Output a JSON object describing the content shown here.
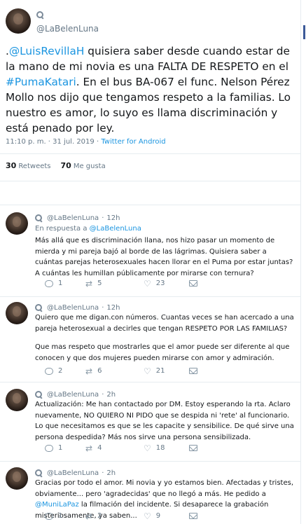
{
  "main_tweet": {
    "handle": "@LaBelenLuna",
    "text_parts": [
      {
        "t": ".",
        "link": false
      },
      {
        "t": "@LuisRevillaH",
        "link": true
      },
      {
        "t": " quisiera saber desde cuando estar de la mano de mi novia es una FALTA DE RESPETO en el ",
        "link": false
      },
      {
        "t": "#PumaKatari",
        "link": true
      },
      {
        "t": ". En el bus BA-067 el func. Nelson Pérez Mollo nos dijo que tengamos respeto a la familias. Lo nuestro es amor, lo suyo es llama discriminación y está penado por ley.",
        "link": false
      }
    ],
    "timestamp": "11:10 p. m. · 31 jul. 2019 · ",
    "source": "Twitter for Android",
    "retweets_count": "30",
    "retweets_label": "Retweets",
    "likes_count": "70",
    "likes_label": "Me gusta"
  },
  "replies": [
    {
      "handle": "@LaBelenLuna",
      "time": "12h",
      "in_reply_prefix": "En respuesta a ",
      "in_reply_handle": "@LaBelenLuna",
      "text": "Más allá que es discriminación llana, nos hizo pasar un momento de mierda y mi pareja bajó al borde de las lágrimas. Quisiera saber a cuántas parejas heterosexuales hacen llorar en el Puma por estar juntas? A cuántas les humillan públicamente por mirarse con ternura?",
      "replies": "1",
      "retweets": "5",
      "likes": "23"
    },
    {
      "handle": "@LaBelenLuna",
      "time": "12h",
      "text": "Quiero que me digan.con números. Cuantas veces se han acercado a una pareja heterosexual a decirles que tengan RESPETO POR LAS FAMILIAS?",
      "text2": "Que mas respeto que mostrarles que el amor puede ser diferente al que conocen y que dos mujeres pueden mirarse con amor y admiración.",
      "replies": "2",
      "retweets": "6",
      "likes": "21"
    },
    {
      "handle": "@LaBelenLuna",
      "time": "2h",
      "text": "Actualización: Me han contactado por DM. Estoy esperando la rta. Aclaro nuevamente, NO QUIERO NI PIDO que se despida ni 'rete' al funcionario. Lo que necesitamos es que se les capacite y sensibilice. De qué sirve una persona despedida? Más nos sirve una persona sensibilizada.",
      "replies": "1",
      "retweets": "4",
      "likes": "18"
    },
    {
      "handle": "@LaBelenLuna",
      "time": "2h",
      "text_before": "Gracias por todo el amor. Mi novia y yo estamos bien. Afectadas y tristes, obviamente... pero 'agradecidas' que no llegó a más. He pedido a ",
      "mention": "@MuniLaPaz",
      "text_after": " la filmación del incidente. Si desaparece la grabación misteriosamente, ya saben...",
      "replies": "1",
      "retweets": "2",
      "likes": "9"
    }
  ],
  "colors": {
    "link": "#1b95e0",
    "muted": "#657786",
    "text": "#14171a",
    "border": "#e6ecf0",
    "accent_bar": "#3b5998"
  },
  "icons": [
    "magnifier-icon",
    "reply-icon",
    "retweet-icon",
    "like-icon",
    "message-icon"
  ]
}
